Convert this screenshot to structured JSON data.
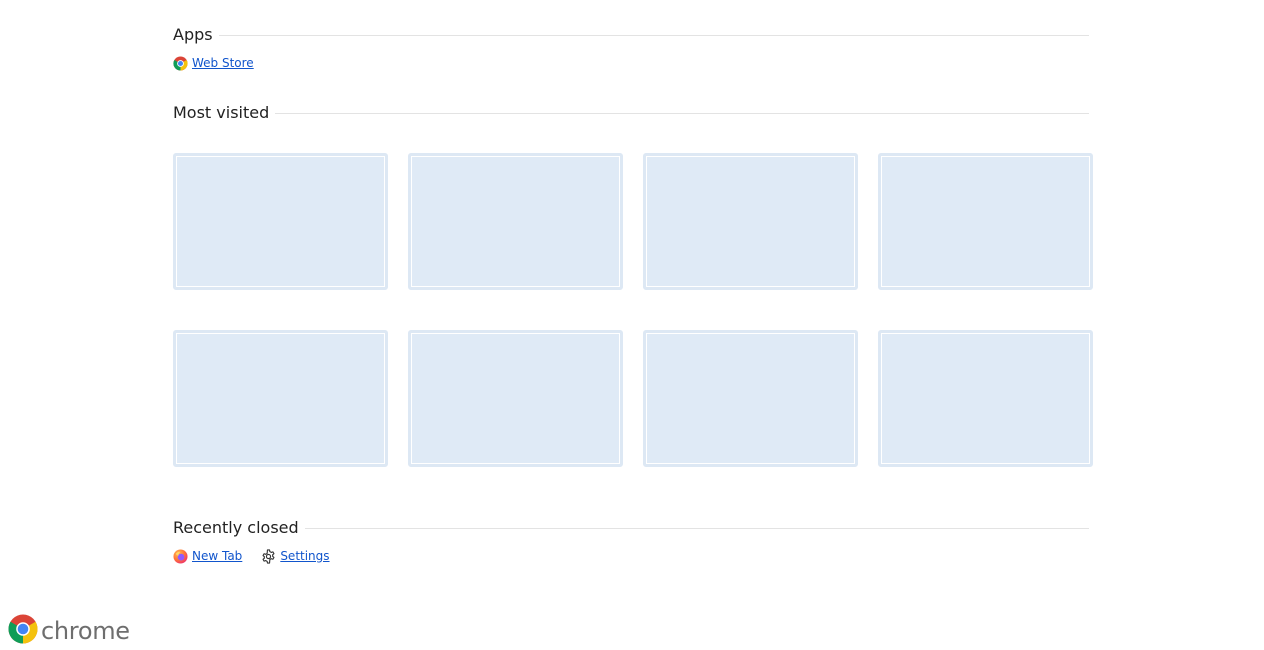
{
  "apps": {
    "title": "Apps",
    "items": [
      {
        "label": "Web Store",
        "icon": "chrome-web-store-icon"
      }
    ]
  },
  "most_visited": {
    "title": "Most visited",
    "tiles": [
      "",
      "",
      "",
      "",
      "",
      "",
      "",
      ""
    ]
  },
  "recently_closed": {
    "title": "Recently closed",
    "items": [
      {
        "label": "New Tab",
        "icon": "firefox-icon"
      },
      {
        "label": "Settings",
        "icon": "gear-icon"
      }
    ]
  },
  "footer": {
    "brand": "chrome"
  },
  "colors": {
    "link": "#1155cc",
    "tile_border": "#dde8f4",
    "tile_fill": "#dfeaf6",
    "rule": "#e3e3e3"
  }
}
